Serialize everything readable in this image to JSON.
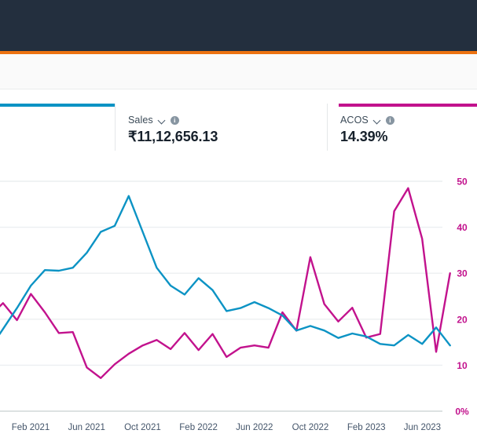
{
  "header": {
    "bar_color": "#232f3e",
    "accent_color": "#ec7211"
  },
  "metric_cards": [
    {
      "name": "clipped-metric",
      "label": "",
      "value": "",
      "accent": "#0c93c4",
      "chevron": "chevron-down-icon",
      "info": "info-icon"
    },
    {
      "name": "sales",
      "label": "Sales",
      "value": "₹11,12,656.13",
      "accent": "#0c93c4",
      "chevron": "chevron-down-icon",
      "info": "info-icon"
    },
    {
      "name": "acos",
      "label": "ACOS",
      "value": "14.39%",
      "accent": "#c2128d",
      "chevron": "chevron-down-icon",
      "info": "info-icon"
    }
  ],
  "chart_data": {
    "type": "line",
    "title": "",
    "xlabel": "",
    "ylabel": "",
    "grid": true,
    "legend_position": "none",
    "x_tick_labels": [
      "Feb 2021",
      "Jun 2021",
      "Oct 2021",
      "Feb 2022",
      "Jun 2022",
      "Oct 2022",
      "Feb 2023",
      "Jun 2023"
    ],
    "right_axis": {
      "label": "ACOS",
      "tick_labels": [
        "0%",
        "10",
        "20",
        "30",
        "40",
        "50"
      ],
      "ticks": [
        0,
        10,
        20,
        30,
        40,
        50
      ],
      "ylim": [
        0,
        55
      ],
      "color": "#c2128d"
    },
    "left_axis": {
      "label": "Sales",
      "ylim": [
        0,
        100
      ],
      "color": "#0c93c4",
      "visible": false
    },
    "x": [
      "Dec 2020",
      "Jan 2021",
      "Feb 2021",
      "Mar 2021",
      "Apr 2021",
      "May 2021",
      "Jun 2021",
      "Jul 2021",
      "Aug 2021",
      "Sep 2021",
      "Oct 2021",
      "Nov 2021",
      "Dec 2021",
      "Jan 2022",
      "Feb 2022",
      "Mar 2022",
      "Apr 2022",
      "May 2022",
      "Jun 2022",
      "Jul 2022",
      "Aug 2022",
      "Sep 2022",
      "Oct 2022",
      "Nov 2022",
      "Dec 2022",
      "Jan 2023",
      "Feb 2023",
      "Mar 2023",
      "Apr 2023",
      "May 2023",
      "Jun 2023",
      "Jul 2023",
      "Aug 2023",
      "Sep 2023"
    ],
    "series": [
      {
        "name": "ACOS",
        "color": "#c2128d",
        "axis": "right",
        "unit": "%",
        "values": [
          20.5,
          23.5,
          19.8,
          25.5,
          21.5,
          17.0,
          17.2,
          9.5,
          7.2,
          10.2,
          12.5,
          14.3,
          15.5,
          13.5,
          17.0,
          13.3,
          16.8,
          11.8,
          13.8,
          14.3,
          13.8,
          21.5,
          17.5,
          33.5,
          23.3,
          19.5,
          22.5,
          16.0,
          16.8,
          43.5,
          48.5,
          37.5,
          12.9,
          30.0
        ]
      },
      {
        "name": "Sales",
        "color": "#0c93c4",
        "axis": "left",
        "unit": "₹",
        "values": [
          20.5,
          27.5,
          34.5,
          42.0,
          47.2,
          47.0,
          48.0,
          53.0,
          60.0,
          62.0,
          72.0,
          60.0,
          48.0,
          42.0,
          39.0,
          44.5,
          40.5,
          33.5,
          34.5,
          36.5,
          34.5,
          32.0,
          27.0,
          28.5,
          27.0,
          24.5,
          26.0,
          25.0,
          22.5,
          22.0,
          25.5,
          22.5,
          28.0,
          22.0
        ]
      }
    ],
    "notes": "Dual-axis monthly line chart; ACOS read against right percent axis, Sales against a hidden left axis. View is horizontally cropped at both edges."
  }
}
